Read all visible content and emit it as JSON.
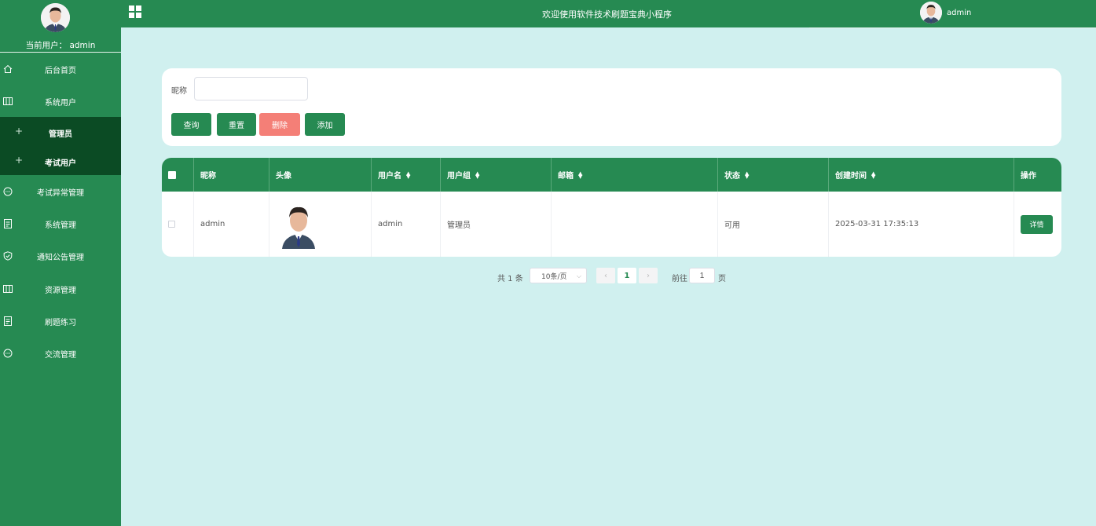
{
  "app": {
    "title": "欢迎使用软件技术刷题宝典小程序",
    "current_user_label": "当前用户：  admin",
    "top_username": "admin"
  },
  "colors": {
    "primary": "#268a52",
    "submenu_bg": "#0b4b24",
    "page_bg": "#d0f0ef",
    "danger": "#f47f77"
  },
  "sidebar": {
    "items": [
      {
        "label": "后台首页",
        "icon": "home-icon"
      },
      {
        "label": "系统用户",
        "icon": "columns-icon"
      },
      {
        "label": "考试异常管理",
        "icon": "chat-icon"
      },
      {
        "label": "系统管理",
        "icon": "document-icon"
      },
      {
        "label": "通知公告管理",
        "icon": "shield-icon"
      },
      {
        "label": "资源管理",
        "icon": "columns-icon"
      },
      {
        "label": "刷题练习",
        "icon": "document-icon"
      },
      {
        "label": "交流管理",
        "icon": "chat-icon"
      }
    ],
    "submenu": [
      {
        "label": "管理员"
      },
      {
        "label": "考试用户"
      }
    ]
  },
  "search": {
    "label": "昵称",
    "value": "",
    "placeholder": "",
    "buttons": {
      "query": "查询",
      "reset": "重置",
      "delete": "删除",
      "add": "添加"
    }
  },
  "table": {
    "columns": [
      "昵称",
      "头像",
      "用户名",
      "用户组",
      "邮箱",
      "状态",
      "创建时间",
      "操作"
    ],
    "rows": [
      {
        "nickname": "admin",
        "username": "admin",
        "group": "管理员",
        "email": "",
        "status": "可用",
        "created": "2025-03-31 17:35:13",
        "action": "详情"
      }
    ]
  },
  "pagination": {
    "total": "共 1 条",
    "page_size": "10条/页",
    "current_page": "1",
    "goto_label": "前往",
    "goto_value": "1",
    "page_suffix": "页"
  }
}
